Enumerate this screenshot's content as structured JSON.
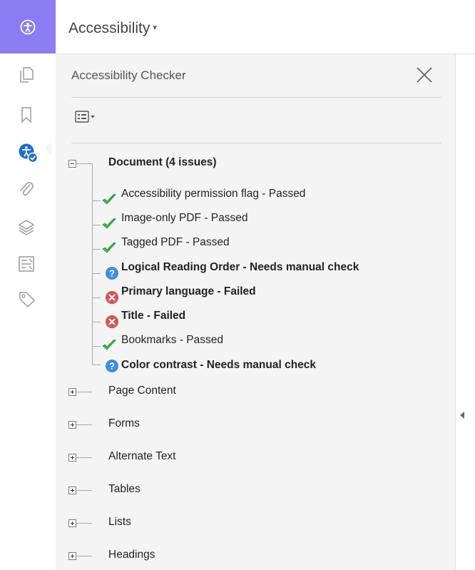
{
  "header": {
    "title": "Accessibility",
    "caret": "▾"
  },
  "rail": {
    "icons": [
      "pages-icon",
      "bookmark-icon",
      "accessibility-check-icon",
      "attachment-icon",
      "layers-icon",
      "content-icon",
      "tags-icon"
    ]
  },
  "panel": {
    "title": "Accessibility Checker"
  },
  "tree": {
    "document": {
      "label": "Document (4 issues)"
    },
    "items": [
      {
        "label": "Accessibility permission flag - Passed",
        "status": "passed"
      },
      {
        "label": "Image-only PDF - Passed",
        "status": "passed"
      },
      {
        "label": "Tagged PDF - Passed",
        "status": "passed"
      },
      {
        "label": "Logical Reading Order - Needs manual check",
        "status": "manual"
      },
      {
        "label": "Primary language - Failed",
        "status": "failed"
      },
      {
        "label": "Title - Failed",
        "status": "failed"
      },
      {
        "label": "Bookmarks - Passed",
        "status": "passed"
      },
      {
        "label": "Color contrast - Needs manual check",
        "status": "manual"
      }
    ],
    "categories": [
      "Page Content",
      "Forms",
      "Alternate Text",
      "Tables",
      "Lists",
      "Headings"
    ]
  },
  "colors": {
    "accent": "#8a7cf2",
    "passed": "#3cb84a",
    "manual": "#3b8fe0",
    "failed": "#d9534f"
  }
}
